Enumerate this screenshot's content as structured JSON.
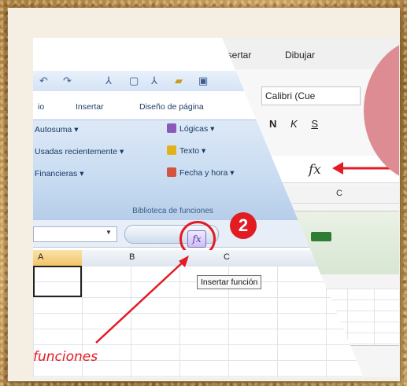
{
  "left_excel": {
    "tabs": [
      "io",
      "Insertar",
      "Diseño de página"
    ],
    "ribbon": {
      "col1": [
        "Autosuma",
        "Usadas recientemente",
        "Financieras"
      ],
      "col2": [
        "Lógicas",
        "Texto",
        "Fecha y hora"
      ],
      "group_label": "Biblioteca de funciones"
    },
    "fx_button": "fx",
    "step_number": "2",
    "columns": [
      "A",
      "B",
      "C"
    ],
    "tooltip": "Insertar función",
    "caption": "funciones"
  },
  "right_excel": {
    "tabs": [
      "nsertar",
      "Dibujar"
    ],
    "font_name": "Calibri (Cue",
    "format_buttons": [
      "N",
      "K",
      "S"
    ],
    "fx_label": "fx",
    "column_c": "C"
  },
  "colors": {
    "accent_red": "#e31b23",
    "pink_overlay": "#de8c93",
    "ribbon_blue": "#c7dbf1"
  }
}
